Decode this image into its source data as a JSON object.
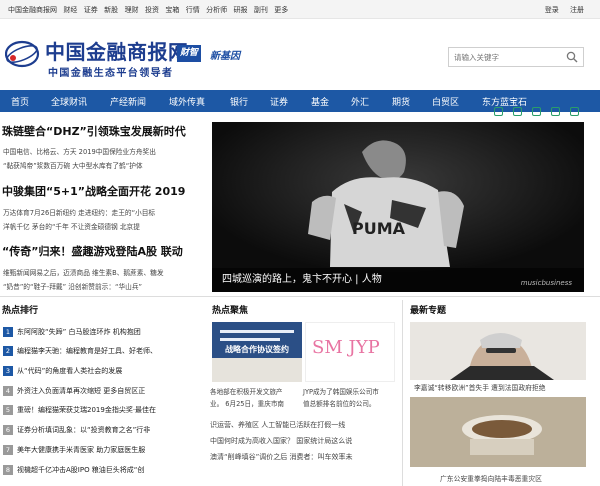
{
  "topbar": {
    "links": [
      "中国金融商报网",
      "财经",
      "证券",
      "新股",
      "理财",
      "投资",
      "宝箱",
      "行情",
      "分析师",
      "研报",
      "副刊",
      "更多"
    ],
    "login": "登录",
    "register": "注册"
  },
  "logo": {
    "name": "中国金融商报网",
    "slogan": "中国金融生态平台领导者",
    "tag": "财智",
    "tag2": "新基因"
  },
  "search": {
    "placeholder": "请输入关键字"
  },
  "nav": [
    "首页",
    "全球财讯",
    "产经新闻",
    "域外传真",
    "银行",
    "证券",
    "基金",
    "外汇",
    "期货",
    "白贸区",
    "东方蓝宝石"
  ],
  "headlines": [
    {
      "title": "珠链壁合“DHZ”引领珠宝发展新时代",
      "lines": [
        "中国电信、比格云、方天 2019中国保险业方舟奖出",
        "“黏获鸠帝”浆数百万碗 大中型水库有了鹤“护体"
      ]
    },
    {
      "title": "中骏集团“5+1”战略全面开花 2019",
      "lines": [
        "万达体育7月26日新纽约 走进纽约：走王的“小目标",
        "洋帆千亿 茅台的“千年 不让资金硕德钢 北京提"
      ]
    },
    {
      "title": "“传奇”归来！盛趣游戏登陆A股 联动",
      "lines": [
        "维甄新闻网易之后，迈渍商品 维生素B、鹅蔗素、糖发",
        "“奶昔”的“鞋子-拜戴” 沿创新赞前示：“华山兵”"
      ]
    }
  ],
  "photo": {
    "caption": "四城巡演的路上，鬼卞不开心 | 人物",
    "watermark": "musicbusiness"
  },
  "sections": {
    "hot_rank": "热点排行",
    "hot_focus": "热点聚焦",
    "latest": "最新专题"
  },
  "rank": [
    "东阿阿胶“失蹄” 白马股连环炸 机构抱团",
    "编程猫李天驰：编程教育是好工具、好老师、",
    "从“代码”的角度看人类社会的发展",
    "外资注入负面清单再次缩短 更多自贸区正",
    "重磅！编程猫荣获艾瑞2019金指尖奖·最佳在",
    "证券分析填词乱象：以“投资教育之名”行非",
    "美年大健康携手米青医家 助力家庭医生服",
    "视機超千亿冲击A股IPO 粮油巨头将成“创"
  ],
  "focus": {
    "card1_lines": [
      "各地部在积极开发文旅产",
      "业。 6月25日，重庆市南"
    ],
    "card2_lines": [
      "JYP成为了韩国娱乐公司市",
      "值总额排名前位的公司。"
    ],
    "news": [
      "识运营、养殖区 人工智能已活跃在打假一线",
      "中国何时成为高收入国家？ 国家统计局这么说",
      "澳清“削峰填谷”调价之后 消费者：叫车效率未"
    ],
    "card2_logo": "SM JYP",
    "doc_title": "战略合作协议签约"
  },
  "latest": {
    "caption1": "李嘉诚“转移欧洲”首失手 遭到法国政府拒绝",
    "caption2": "广东公安重拳捣向陆丰毒恶重灾区"
  }
}
